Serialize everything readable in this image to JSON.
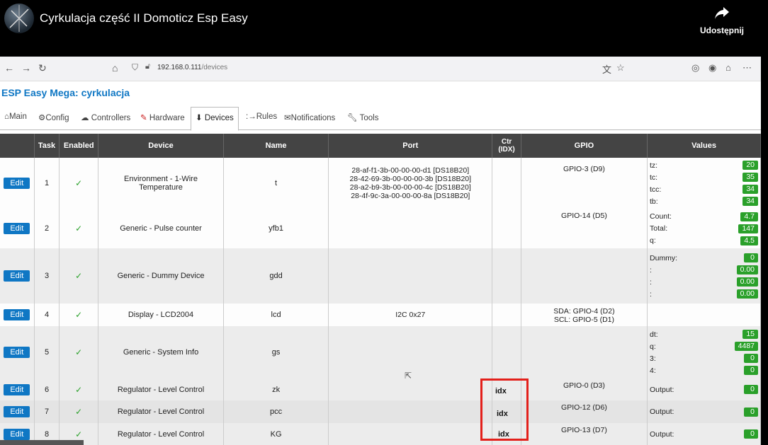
{
  "video": {
    "title": "Cyrkulacja część II Domoticz Esp Easy",
    "share_label": "Udostępnij"
  },
  "browser": {
    "url_host": "192.168.0.111",
    "url_path": "/devices"
  },
  "esp": {
    "title": "ESP Easy Mega: cyrkulacja",
    "tabs": [
      {
        "label": "Main",
        "icon": "home-icon"
      },
      {
        "label": "Config",
        "icon": "gear-icon"
      },
      {
        "label": "Controllers",
        "icon": "cloud-icon"
      },
      {
        "label": "Hardware",
        "icon": "pin-icon"
      },
      {
        "label": "Devices",
        "icon": "plug-icon"
      },
      {
        "label": "Rules",
        "icon": "arrow-icon"
      },
      {
        "label": "Notifications",
        "icon": "envelope-icon"
      },
      {
        "label": "Tools",
        "icon": "wrench-icon"
      }
    ],
    "active_tab": "Devices"
  },
  "table": {
    "headers": [
      "",
      "Task",
      "Enabled",
      "Device",
      "Name",
      "Port",
      "Ctr\n(IDX)",
      "GPIO",
      "Values"
    ],
    "edit_label": "Edit",
    "check": "✓",
    "rows": [
      {
        "task": "1",
        "device": "Environment - 1-Wire Temperature",
        "name": "t",
        "port": [
          "28-af-f1-3b-00-00-00-d1 [DS18B20]",
          "28-42-69-3b-00-00-00-3b [DS18B20]",
          "28-a2-b9-3b-00-00-00-4c [DS18B20]",
          "28-4f-9c-3a-00-00-00-8a [DS18B20]"
        ],
        "gpio": [
          "GPIO-3 (D9)"
        ],
        "values": [
          {
            "k": "tz:",
            "v": "20"
          },
          {
            "k": "tc:",
            "v": "35"
          },
          {
            "k": "tcc:",
            "v": "34"
          },
          {
            "k": "tb:",
            "v": "34"
          }
        ]
      },
      {
        "task": "2",
        "device": "Generic - Pulse counter",
        "name": "yfb1",
        "port": [],
        "gpio": [
          "GPIO-14 (D5)"
        ],
        "values": [
          {
            "k": "Count:",
            "v": "4.7"
          },
          {
            "k": "Total:",
            "v": "147"
          },
          {
            "k": "q:",
            "v": "4.5"
          }
        ]
      },
      {
        "task": "3",
        "device": "Generic - Dummy Device",
        "name": "gdd",
        "port": [],
        "gpio": [],
        "values": [
          {
            "k": "Dummy:",
            "v": "0"
          },
          {
            "k": ":",
            "v": "0.00"
          },
          {
            "k": ":",
            "v": "0.00"
          },
          {
            "k": ":",
            "v": "0.00"
          }
        ]
      },
      {
        "task": "4",
        "device": "Display - LCD2004",
        "name": "lcd",
        "port": [
          "I2C 0x27"
        ],
        "gpio": [
          "SDA: GPIO-4 (D2)",
          "SCL: GPIO-5 (D1)"
        ],
        "values": []
      },
      {
        "task": "5",
        "device": "Generic - System Info",
        "name": "gs",
        "port": [],
        "gpio": [],
        "values": [
          {
            "k": "dt:",
            "v": "15"
          },
          {
            "k": "q:",
            "v": "4487"
          },
          {
            "k": "3:",
            "v": "0"
          },
          {
            "k": "4:",
            "v": "0"
          }
        ]
      },
      {
        "task": "6",
        "device": "Regulator - Level Control",
        "name": "zk",
        "port": [],
        "gpio": [
          "GPIO-0 (D3)"
        ],
        "values": [
          {
            "k": "Output:",
            "v": "0"
          }
        ]
      },
      {
        "task": "7",
        "device": "Regulator - Level Control",
        "name": "pcc",
        "port": [],
        "gpio": [
          "GPIO-12 (D6)"
        ],
        "values": [
          {
            "k": "Output:",
            "v": "0"
          }
        ]
      },
      {
        "task": "8",
        "device": "Regulator - Level Control",
        "name": "KG",
        "port": [],
        "gpio": [
          "GPIO-13 (D7)"
        ],
        "values": [
          {
            "k": "Output:",
            "v": "0"
          }
        ]
      }
    ]
  },
  "annotation": {
    "labels": [
      "idx",
      "idx",
      "idx"
    ],
    "box_color": "#e3201b"
  }
}
